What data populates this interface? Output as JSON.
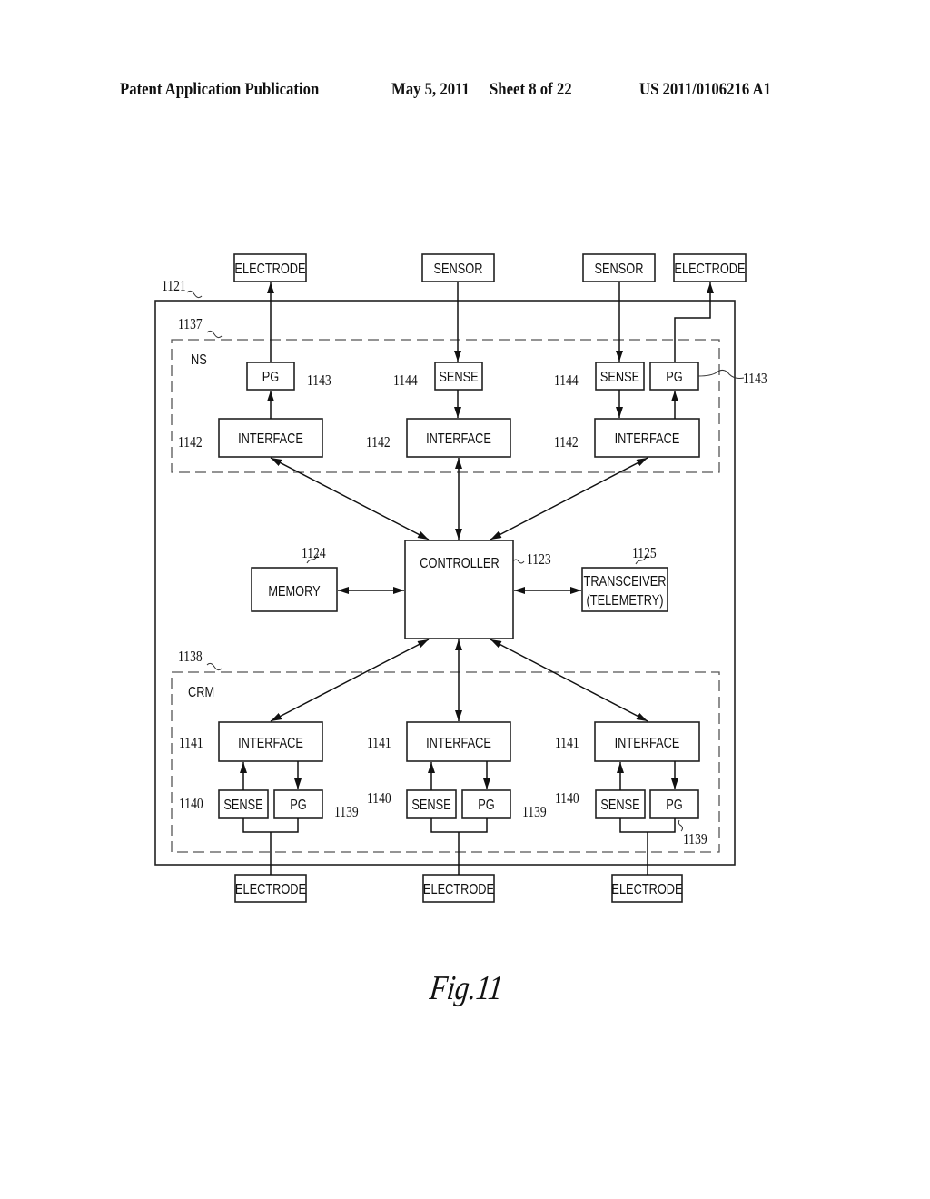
{
  "header": {
    "publication": "Patent Application Publication",
    "date": "May 5, 2011",
    "sheet": "Sheet 8 of 22",
    "number": "US 2011/0106216 A1"
  },
  "figure_label": "Fig.11",
  "device": {
    "ref": "1121"
  },
  "ns_group": {
    "ref": "1137",
    "label": "NS",
    "channels": [
      {
        "external": "ELECTRODE",
        "direction": "output",
        "block": "PG",
        "block_ref": "1143",
        "interface": "INTERFACE",
        "interface_ref": "1142"
      },
      {
        "external": "SENSOR",
        "direction": "input",
        "block": "SENSE",
        "block_ref": "1144",
        "interface": "INTERFACE",
        "interface_ref": "1142"
      },
      {
        "external_sensor": "SENSOR",
        "external_electrode": "ELECTRODE",
        "sense": "SENSE",
        "sense_ref": "1144",
        "pg": "PG",
        "pg_ref": "1143",
        "interface": "INTERFACE",
        "interface_ref": "1142"
      }
    ]
  },
  "controller": {
    "label": "CONTROLLER",
    "ref": "1123"
  },
  "memory": {
    "label": "MEMORY",
    "ref": "1124"
  },
  "transceiver": {
    "line1": "TRANSCEIVER",
    "line2": "(TELEMETRY)",
    "ref": "1125"
  },
  "crm_group": {
    "ref": "1138",
    "label": "CRM",
    "channels": [
      {
        "interface": "INTERFACE",
        "interface_ref": "1141",
        "sense": "SENSE",
        "sense_ref": "1140",
        "pg": "PG",
        "pg_ref": "1139",
        "electrode": "ELECTRODE"
      },
      {
        "interface": "INTERFACE",
        "interface_ref": "1141",
        "sense": "SENSE",
        "sense_ref": "1140",
        "pg": "PG",
        "pg_ref": "1139",
        "electrode": "ELECTRODE"
      },
      {
        "interface": "INTERFACE",
        "interface_ref": "1141",
        "sense": "SENSE",
        "sense_ref": "1140",
        "pg": "PG",
        "pg_ref": "1139",
        "electrode": "ELECTRODE"
      }
    ]
  }
}
